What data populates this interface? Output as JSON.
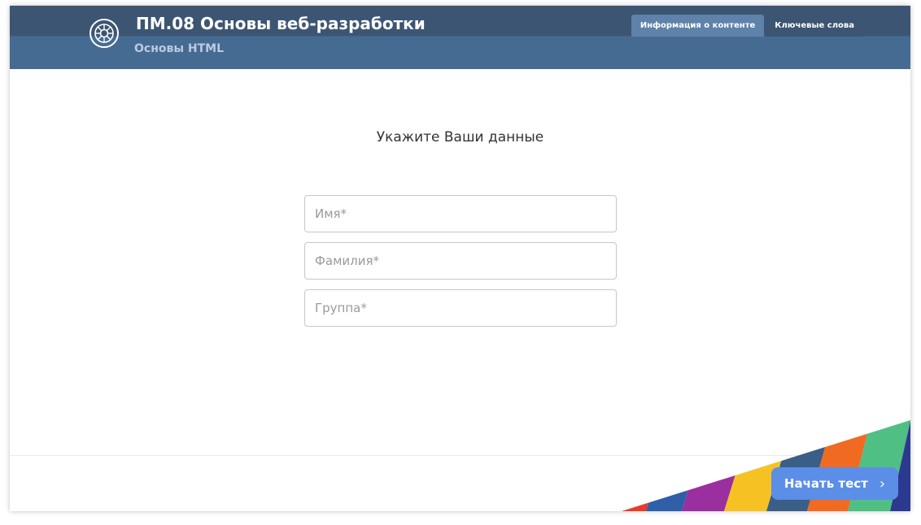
{
  "header": {
    "title": "ПМ.08 Основы веб-разработки",
    "subtitle": "Основы HTML",
    "tabs": [
      {
        "label": "Информация о контенте"
      },
      {
        "label": "Ключевые слова"
      }
    ]
  },
  "form": {
    "title": "Укажите Ваши данные",
    "fields": [
      {
        "placeholder": "Имя*",
        "value": ""
      },
      {
        "placeholder": "Фамилия*",
        "value": ""
      },
      {
        "placeholder": "Группа*",
        "value": ""
      }
    ]
  },
  "footer": {
    "start_label": "Начать тест",
    "start_icon": "chevron-right-icon"
  },
  "colors": {
    "header_dark": "#3c5573",
    "header_light": "#466b93",
    "button": "#5b8ee6",
    "stripes": [
      "#e83b2b",
      "#2f5fa8",
      "#9b2f9f",
      "#f6c223",
      "#3a5e86",
      "#f06a22",
      "#4fbf84",
      "#2b3a8f"
    ]
  }
}
